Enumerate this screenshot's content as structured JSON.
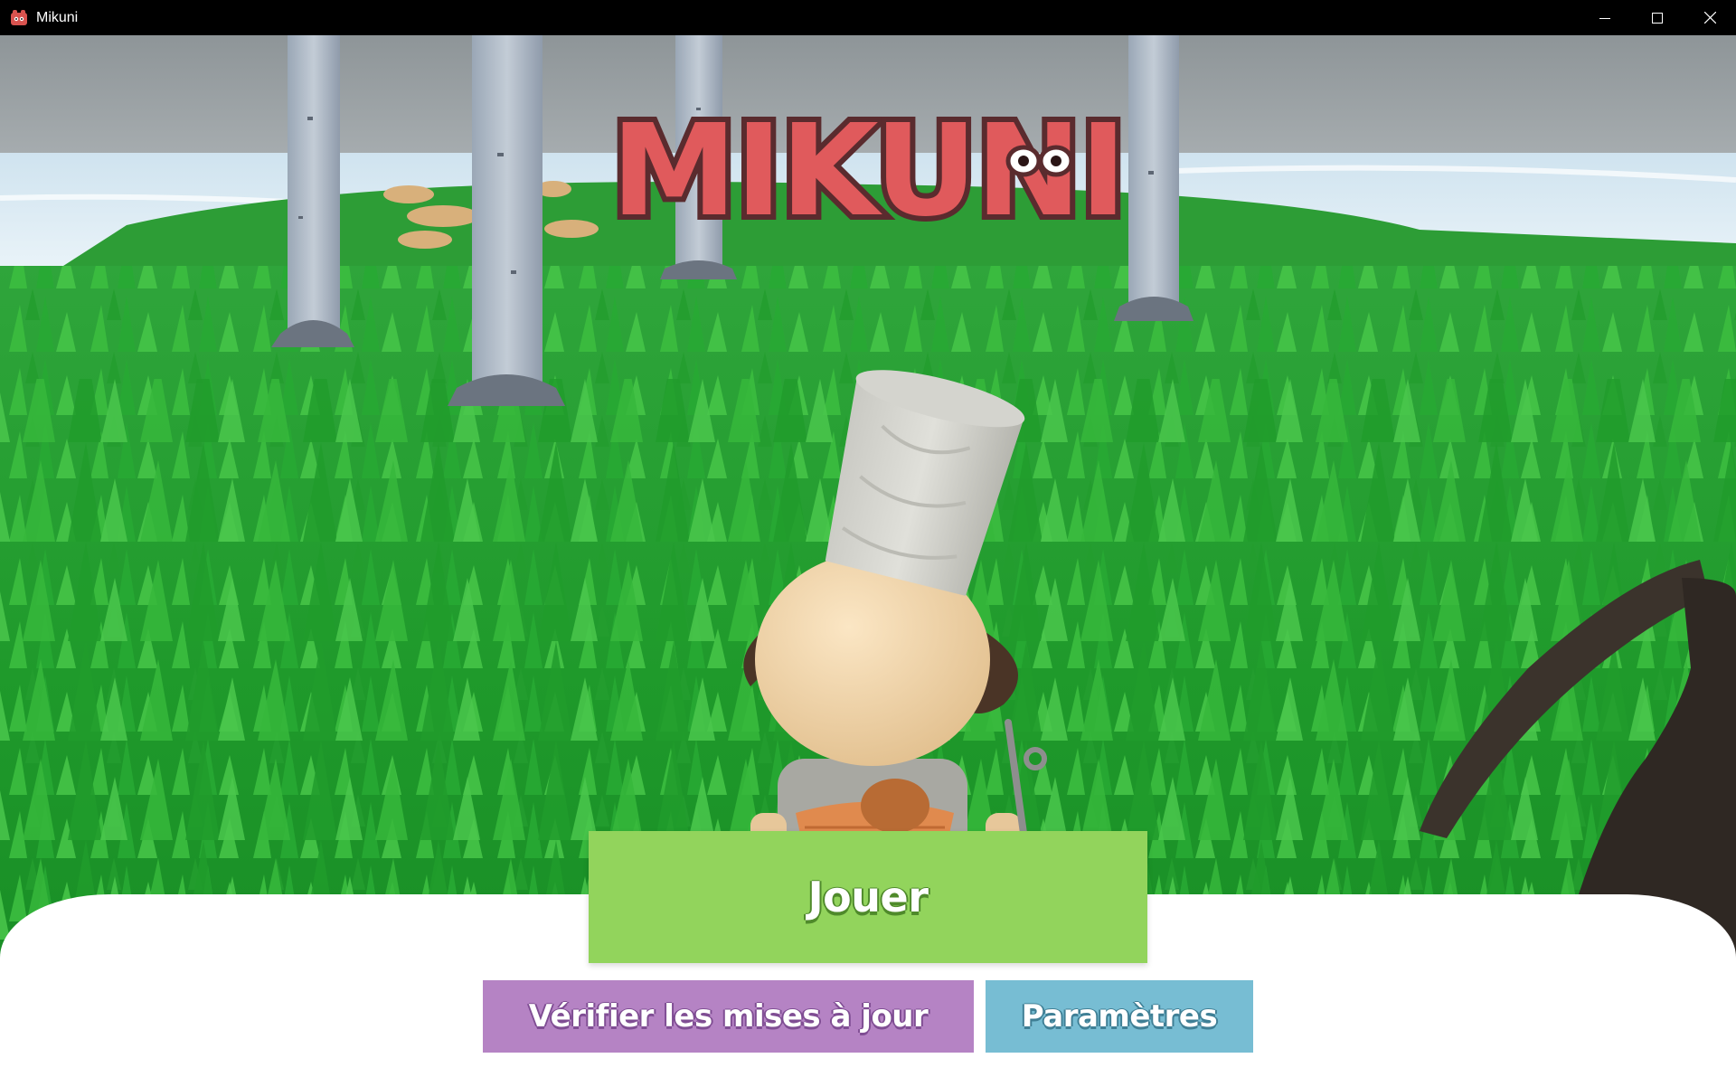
{
  "window": {
    "title": "Mikuni",
    "app_icon": "mikuni-app-icon",
    "controls": {
      "minimize_icon": "minimize-icon",
      "maximize_icon": "maximize-icon",
      "close_icon": "close-icon"
    }
  },
  "game": {
    "logo_text": "MIKUNI",
    "colors": {
      "logo_fill": "#e05a5c",
      "logo_outline": "#5a2b2e",
      "play_button": "#92d45c",
      "updates_button": "#b583c4",
      "settings_button": "#77bdd3",
      "panel": "#ffffff"
    }
  },
  "menu": {
    "play_label": "Jouer",
    "check_updates_label": "Vérifier les mises à jour",
    "settings_label": "Paramètres"
  }
}
